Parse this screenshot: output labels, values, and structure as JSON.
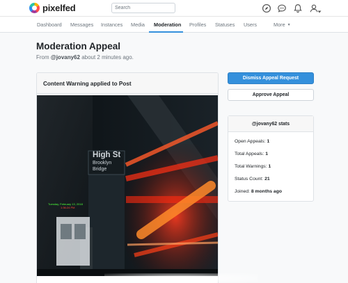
{
  "header": {
    "brand": "pixelfed",
    "search_placeholder": "Search",
    "icons": [
      "compass-icon",
      "chat-bubble-icon",
      "bell-icon",
      "user-icon",
      "caret-down-icon"
    ]
  },
  "nav": {
    "tabs": [
      {
        "label": "Dashboard"
      },
      {
        "label": "Messages"
      },
      {
        "label": "Instances"
      },
      {
        "label": "Media"
      },
      {
        "label": "Moderation",
        "active": true
      },
      {
        "label": "Profiles"
      },
      {
        "label": "Statuses"
      },
      {
        "label": "Users"
      },
      {
        "label": "More"
      }
    ]
  },
  "page": {
    "title": "Moderation Appeal",
    "subtitle_prefix": "From",
    "username": "@jovany62",
    "subtitle_suffix": "about 2 minutes ago."
  },
  "post": {
    "heading": "Content Warning applied to Post",
    "image_text": {
      "sign_line1": "High St",
      "sign_line2": "Brooklyn",
      "sign_line3": "Bridge"
    }
  },
  "actions": {
    "dismiss_label": "Dismiss Appeal Request",
    "approve_label": "Approve Appeal"
  },
  "stats": {
    "heading": "@jovany62 stats",
    "rows": [
      {
        "label": "Open Appeals:",
        "value": "1"
      },
      {
        "label": "Total Appeals:",
        "value": "1"
      },
      {
        "label": "Total Warnings:",
        "value": "1"
      },
      {
        "label": "Status Count:",
        "value": "21"
      },
      {
        "label": "Joined:",
        "value": "8 months ago"
      }
    ]
  },
  "colors": {
    "accent": "#3490dc",
    "page_bg": "#f8f9fa"
  }
}
